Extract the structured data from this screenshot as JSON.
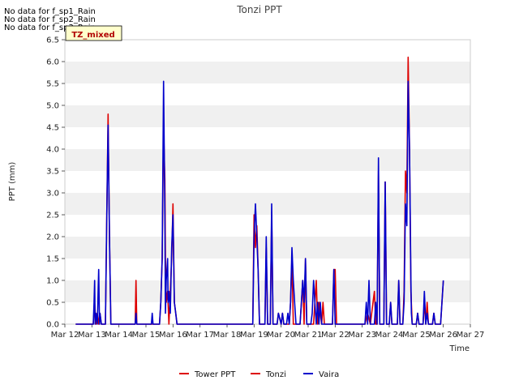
{
  "chart_data": {
    "type": "line",
    "title": "Tonzi PPT",
    "xlabel": "Time",
    "ylabel": "PPT (mm)",
    "ylim": [
      0,
      6.5
    ],
    "y_ticks": [
      "0.0",
      "0.5",
      "1.0",
      "1.5",
      "2.0",
      "2.5",
      "3.0",
      "3.5",
      "4.0",
      "4.5",
      "5.0",
      "5.5",
      "6.0",
      "6.5"
    ],
    "x_ticks": [
      "Mar 12",
      "Mar 13",
      "Mar 14",
      "Mar 15",
      "Mar 16",
      "Mar 17",
      "Mar 18",
      "Mar 19",
      "Mar 20",
      "Mar 21",
      "Mar 22",
      "Mar 23",
      "Mar 24",
      "Mar 25",
      "Mar 26",
      "Mar 27"
    ],
    "x_unit": "days from Mar 12",
    "grid": "horizontal bands",
    "legend_position": "bottom-center",
    "no_data_notes": [
      "No data for f_sp1_Rain",
      "No data for f_sp2_Rain",
      "No data for f_sp3_Rain"
    ],
    "tz_label": "TZ_mixed",
    "series": [
      {
        "name": "Tower PPT",
        "color": "#dd0000",
        "points": []
      },
      {
        "name": "Tonzi",
        "color": "#dd0000",
        "points": [
          [
            0.4,
            0
          ],
          [
            1.05,
            0
          ],
          [
            1.1,
            0.5
          ],
          [
            1.15,
            0
          ],
          [
            1.2,
            0.25
          ],
          [
            1.25,
            0
          ],
          [
            1.3,
            0.25
          ],
          [
            1.35,
            0
          ],
          [
            1.5,
            0
          ],
          [
            1.55,
            2.5
          ],
          [
            1.6,
            4.8
          ],
          [
            1.65,
            2.0
          ],
          [
            1.7,
            0
          ],
          [
            2.6,
            0
          ],
          [
            2.63,
            1.0
          ],
          [
            2.66,
            0
          ],
          [
            3.5,
            0
          ],
          [
            3.55,
            0.5
          ],
          [
            3.6,
            1.5
          ],
          [
            3.65,
            4.5
          ],
          [
            3.7,
            3.3
          ],
          [
            3.72,
            1.5
          ],
          [
            3.75,
            0.5
          ],
          [
            3.8,
            0.75
          ],
          [
            3.85,
            0
          ],
          [
            3.9,
            0.75
          ],
          [
            3.95,
            1.5
          ],
          [
            4.0,
            2.75
          ],
          [
            4.05,
            0.5
          ],
          [
            4.1,
            0.25
          ],
          [
            4.15,
            0
          ],
          [
            6.95,
            0
          ],
          [
            7.0,
            2.5
          ],
          [
            7.05,
            1.75
          ],
          [
            7.1,
            2.25
          ],
          [
            7.15,
            1.25
          ],
          [
            7.2,
            0
          ],
          [
            7.4,
            0
          ],
          [
            7.45,
            1.75
          ],
          [
            7.5,
            0
          ],
          [
            7.6,
            0
          ],
          [
            7.65,
            2.5
          ],
          [
            7.7,
            0
          ],
          [
            7.85,
            0
          ],
          [
            7.9,
            0.25
          ],
          [
            8.0,
            0
          ],
          [
            8.05,
            0.25
          ],
          [
            8.1,
            0
          ],
          [
            8.3,
            0
          ],
          [
            8.35,
            0.5
          ],
          [
            8.4,
            1.5
          ],
          [
            8.45,
            0
          ],
          [
            8.7,
            0
          ],
          [
            8.75,
            0.5
          ],
          [
            8.8,
            1.0
          ],
          [
            8.85,
            0
          ],
          [
            8.9,
            1.5
          ],
          [
            8.95,
            0
          ],
          [
            9.2,
            0
          ],
          [
            9.25,
            0.5
          ],
          [
            9.3,
            1.0
          ],
          [
            9.35,
            0
          ],
          [
            9.4,
            0.5
          ],
          [
            9.5,
            0
          ],
          [
            9.55,
            0.5
          ],
          [
            9.6,
            0
          ],
          [
            9.9,
            0
          ],
          [
            9.95,
            1.25
          ],
          [
            10.0,
            1.25
          ],
          [
            10.05,
            0
          ],
          [
            11.1,
            0
          ],
          [
            11.2,
            0.25
          ],
          [
            11.3,
            0
          ],
          [
            11.4,
            0.5
          ],
          [
            11.45,
            0.75
          ],
          [
            11.5,
            0
          ],
          [
            11.55,
            0
          ],
          [
            11.6,
            3.5
          ],
          [
            11.65,
            0
          ],
          [
            11.8,
            0
          ],
          [
            11.85,
            3.25
          ],
          [
            11.9,
            0
          ],
          [
            12.0,
            0
          ],
          [
            12.05,
            0.5
          ],
          [
            12.1,
            0
          ],
          [
            12.3,
            0
          ],
          [
            12.35,
            1.0
          ],
          [
            12.4,
            0
          ],
          [
            12.5,
            0
          ],
          [
            12.55,
            0.75
          ],
          [
            12.6,
            3.5
          ],
          [
            12.65,
            3.0
          ],
          [
            12.7,
            6.1
          ],
          [
            12.75,
            4.0
          ],
          [
            12.8,
            0.75
          ],
          [
            12.85,
            0
          ],
          [
            13.0,
            0
          ],
          [
            13.05,
            0.25
          ],
          [
            13.1,
            0
          ],
          [
            13.25,
            0
          ],
          [
            13.3,
            0.5
          ],
          [
            13.35,
            0
          ],
          [
            13.4,
            0.5
          ],
          [
            13.45,
            0
          ],
          [
            13.6,
            0
          ],
          [
            13.65,
            0.25
          ],
          [
            13.7,
            0
          ],
          [
            13.9,
            0
          ],
          [
            13.95,
            0.5
          ],
          [
            14.0,
            1.0
          ]
        ]
      },
      {
        "name": "Vaira",
        "color": "#0000cc",
        "points": [
          [
            0.4,
            0
          ],
          [
            1.05,
            0
          ],
          [
            1.08,
            0.5
          ],
          [
            1.1,
            1.0
          ],
          [
            1.12,
            0
          ],
          [
            1.15,
            0.25
          ],
          [
            1.2,
            0
          ],
          [
            1.25,
            1.25
          ],
          [
            1.28,
            0
          ],
          [
            1.3,
            0.25
          ],
          [
            1.35,
            0
          ],
          [
            1.5,
            0
          ],
          [
            1.55,
            2.5
          ],
          [
            1.6,
            4.55
          ],
          [
            1.65,
            2.0
          ],
          [
            1.7,
            0
          ],
          [
            2.6,
            0
          ],
          [
            2.63,
            0.25
          ],
          [
            2.66,
            0
          ],
          [
            3.2,
            0
          ],
          [
            3.23,
            0.25
          ],
          [
            3.26,
            0
          ],
          [
            3.5,
            0
          ],
          [
            3.55,
            0.5
          ],
          [
            3.6,
            1.5
          ],
          [
            3.65,
            5.55
          ],
          [
            3.7,
            2.5
          ],
          [
            3.72,
            0.25
          ],
          [
            3.75,
            1.0
          ],
          [
            3.8,
            1.5
          ],
          [
            3.82,
            0.5
          ],
          [
            3.85,
            0.75
          ],
          [
            3.9,
            0.25
          ],
          [
            3.95,
            1.75
          ],
          [
            4.0,
            2.5
          ],
          [
            4.05,
            0.5
          ],
          [
            4.1,
            0.25
          ],
          [
            4.15,
            0
          ],
          [
            6.95,
            0
          ],
          [
            7.0,
            2.0
          ],
          [
            7.05,
            2.75
          ],
          [
            7.1,
            2.0
          ],
          [
            7.15,
            1.25
          ],
          [
            7.2,
            0
          ],
          [
            7.4,
            0
          ],
          [
            7.45,
            2.0
          ],
          [
            7.5,
            0
          ],
          [
            7.6,
            0
          ],
          [
            7.65,
            2.75
          ],
          [
            7.7,
            0
          ],
          [
            7.85,
            0
          ],
          [
            7.9,
            0.25
          ],
          [
            8.0,
            0
          ],
          [
            8.05,
            0.25
          ],
          [
            8.1,
            0
          ],
          [
            8.2,
            0
          ],
          [
            8.25,
            0.25
          ],
          [
            8.3,
            0
          ],
          [
            8.35,
            0.5
          ],
          [
            8.4,
            1.75
          ],
          [
            8.45,
            1.0
          ],
          [
            8.5,
            0.5
          ],
          [
            8.55,
            0
          ],
          [
            8.7,
            0
          ],
          [
            8.75,
            0.5
          ],
          [
            8.8,
            1.0
          ],
          [
            8.85,
            0.5
          ],
          [
            8.9,
            1.5
          ],
          [
            8.95,
            0
          ],
          [
            9.1,
            0
          ],
          [
            9.15,
            0.25
          ],
          [
            9.2,
            1.0
          ],
          [
            9.25,
            0.5
          ],
          [
            9.3,
            0
          ],
          [
            9.35,
            0.5
          ],
          [
            9.4,
            0
          ],
          [
            9.45,
            0.5
          ],
          [
            9.5,
            0
          ],
          [
            9.9,
            0
          ],
          [
            9.95,
            1.25
          ],
          [
            10.0,
            0
          ],
          [
            11.1,
            0
          ],
          [
            11.15,
            0.5
          ],
          [
            11.2,
            0
          ],
          [
            11.25,
            1.0
          ],
          [
            11.3,
            0
          ],
          [
            11.45,
            0
          ],
          [
            11.5,
            0.5
          ],
          [
            11.55,
            0
          ],
          [
            11.6,
            3.8
          ],
          [
            11.65,
            0
          ],
          [
            11.8,
            0
          ],
          [
            11.85,
            3.25
          ],
          [
            11.9,
            0
          ],
          [
            12.0,
            0
          ],
          [
            12.05,
            0.5
          ],
          [
            12.1,
            0
          ],
          [
            12.3,
            0
          ],
          [
            12.35,
            1.0
          ],
          [
            12.4,
            0
          ],
          [
            12.5,
            0
          ],
          [
            12.55,
            0.5
          ],
          [
            12.6,
            2.75
          ],
          [
            12.65,
            2.25
          ],
          [
            12.7,
            5.55
          ],
          [
            12.75,
            4.0
          ],
          [
            12.8,
            1.0
          ],
          [
            12.82,
            0.25
          ],
          [
            12.85,
            0
          ],
          [
            13.0,
            0
          ],
          [
            13.05,
            0.25
          ],
          [
            13.1,
            0
          ],
          [
            13.25,
            0
          ],
          [
            13.3,
            0.75
          ],
          [
            13.35,
            0
          ],
          [
            13.4,
            0.25
          ],
          [
            13.45,
            0
          ],
          [
            13.6,
            0
          ],
          [
            13.65,
            0.25
          ],
          [
            13.7,
            0
          ],
          [
            13.9,
            0
          ],
          [
            13.95,
            0.5
          ],
          [
            14.0,
            1.0
          ]
        ]
      }
    ]
  }
}
